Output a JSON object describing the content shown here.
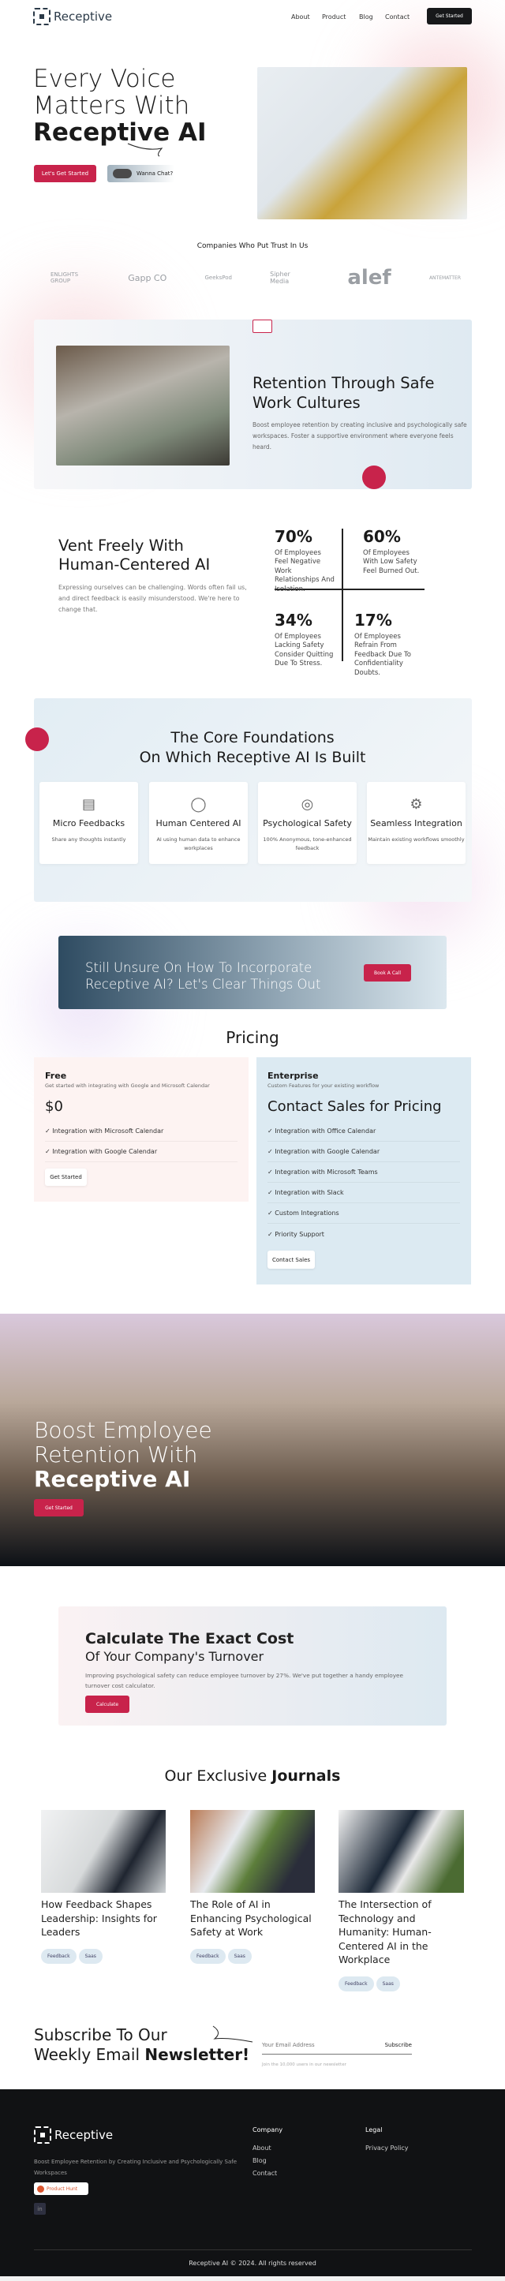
{
  "header": {
    "brand": "Receptive",
    "nav": [
      "About",
      "Product",
      "Blog",
      "Contact"
    ],
    "cta": "Get Started"
  },
  "hero": {
    "line1": "Every Voice",
    "line2": "Matters With",
    "line3": "Receptive AI",
    "primary": "Let's Get Started",
    "chat": "Wanna Chat?"
  },
  "trust": {
    "title": "Companies Who Put Trust In Us",
    "logos": [
      "ENLIGHTS GROUP",
      "Gapp CO",
      "GeeksPod",
      "Sipher Media",
      "alef",
      "ANTEMATTER"
    ]
  },
  "retention": {
    "title": "Retention Through Safe Work Cultures",
    "body": "Boost employee retention by creating inclusive and psychologically safe workspaces. Foster a supportive environment where everyone feels heard."
  },
  "vent": {
    "title_l1": "Vent Freely With",
    "title_l2": "Human-Centered AI",
    "body": "Expressing ourselves can be challenging. Words often fail us, and direct feedback is easily misunderstood. We're here to change that.",
    "stats": [
      {
        "value": "70%",
        "text": "Of Employees Feel Negative Work Relationships And Isolation."
      },
      {
        "value": "60%",
        "text": "Of Employees With Low Safety Feel Burned Out."
      },
      {
        "value": "34%",
        "text": "Of Employees Lacking Safety Consider Quitting Due To Stress."
      },
      {
        "value": "17%",
        "text": "Of Employees Refrain From Feedback Due To Confidentiality Doubts."
      }
    ]
  },
  "core": {
    "title_l1": "The Core Foundations",
    "title_l2": "On Which Receptive AI Is Built",
    "cards": [
      {
        "icon": "feedback-icon",
        "title": "Micro Feedbacks",
        "desc": "Share any thoughts instantly"
      },
      {
        "icon": "headset-icon",
        "title": "Human Centered AI",
        "desc": "AI using human data to enhance workplaces"
      },
      {
        "icon": "brain-icon",
        "title": "Psychological Safety",
        "desc": "100% Anonymous, tone-enhanced feedback"
      },
      {
        "icon": "gears-icon",
        "title": "Seamless Integration",
        "desc": "Maintain existing workflows smoothly"
      }
    ]
  },
  "cta": {
    "l1": "Still Unsure On How To Incorporate",
    "l2": "Receptive AI? Let's Clear Things Out",
    "button": "Book A Call"
  },
  "pricing": {
    "title": "Pricing",
    "free": {
      "name": "Free",
      "subtitle": "Get started with integrating with Google and Microsoft Calendar",
      "price": "$0",
      "features": [
        "Integration with Microsoft Calendar",
        "Integration with Google Calendar"
      ],
      "button": "Get Started"
    },
    "enterprise": {
      "name": "Enterprise",
      "subtitle": "Custom Features for your existing workflow",
      "price": "Contact Sales for Pricing",
      "features": [
        "Integration with Office Calendar",
        "Integration with Google Calendar",
        "Integration with Microsoft Teams",
        "Integration with Slack",
        "Custom Integrations",
        "Priority Support"
      ],
      "button": "Contact Sales"
    }
  },
  "boost": {
    "l1": "Boost Employee",
    "l2": "Retention With",
    "l3": "Receptive AI",
    "button": "Get Started"
  },
  "calc": {
    "l1": "Calculate The Exact Cost",
    "l2": "Of Your Company's Turnover",
    "body": "Improving psychological safety can reduce employee turnover by 27%. We've put together a handy employee turnover cost calculator.",
    "button": "Calculate"
  },
  "journals": {
    "title_a": "Our Exclusive",
    "title_b": "Journals",
    "items": [
      {
        "title": "How Feedback Shapes Leadership: Insights for Leaders",
        "tags": [
          "Feedback",
          "Saas"
        ]
      },
      {
        "title": "The Role of AI in Enhancing Psychological Safety at Work",
        "tags": [
          "Feedback",
          "Saas"
        ]
      },
      {
        "title": "The Intersection of Technology and Humanity: Human-Centered AI in the Workplace",
        "tags": [
          "Feedback",
          "Saas"
        ]
      }
    ]
  },
  "newsletter": {
    "l1": "Subscribe To Our",
    "l2a": "Weekly Email",
    "l2b": "Newsletter!",
    "placeholder": "Your Email Address",
    "button": "Subscribe",
    "note": "Join the 10,000 users in our newsletter"
  },
  "footer": {
    "brand": "Receptive",
    "desc": "Boost Employee Retention by Creating Inclusive and Psychologically Safe Workspaces",
    "badge": "Product Hunt",
    "company_title": "Company",
    "company_links": [
      "About",
      "Blog",
      "Contact"
    ],
    "legal_title": "Legal",
    "legal_links": [
      "Privacy Policy"
    ],
    "copyright": "Receptive AI © 2024. All rights reserved"
  },
  "colors": {
    "accent": "#c8234b",
    "dark": "#111214",
    "panel": "#e3edf4"
  }
}
